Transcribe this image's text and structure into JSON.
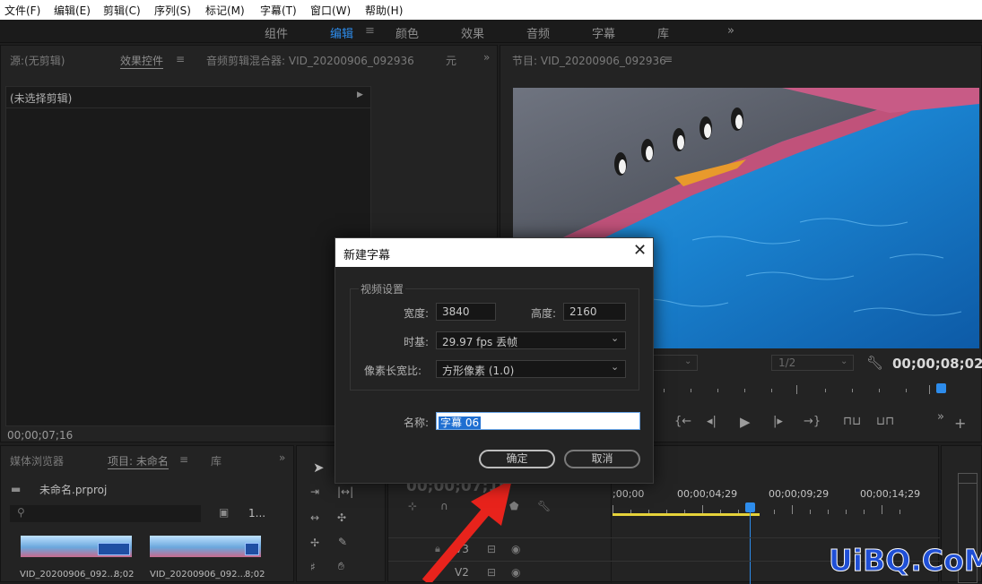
{
  "menu": [
    "文件(F)",
    "编辑(E)",
    "剪辑(C)",
    "序列(S)",
    "标记(M)",
    "字幕(T)",
    "窗口(W)",
    "帮助(H)"
  ],
  "workspaces": [
    "组件",
    "编辑",
    "颜色",
    "效果",
    "音频",
    "字幕",
    "库"
  ],
  "workspace_more": "»",
  "source_panel": {
    "tabs": [
      "源:(无剪辑)",
      "效果控件",
      "音频剪辑混合器: VID_20200906_092936",
      "元"
    ],
    "no_clip": "(未选择剪辑)",
    "timecode": "00;00;07;16"
  },
  "program_panel": {
    "title": "节目: VID_20200906_092936",
    "zoom": "1/2",
    "timecode": "00;00;08;02"
  },
  "project_panel": {
    "tabs": [
      "媒体浏览器",
      "项目: 未命名",
      "库"
    ],
    "project_file": "未命名.prproj",
    "count": "1...",
    "clips": [
      {
        "name": "VID_20200906_092...",
        "duration": "8;02"
      },
      {
        "name": "VID_20200906_092...",
        "duration": "8;02"
      }
    ]
  },
  "timeline": {
    "timecode": "00;00;07;16",
    "ruler": [
      ";00;00",
      "00;00;04;29",
      "00;00;09;29",
      "00;00;14;29"
    ],
    "tracks": [
      "V3",
      "V2"
    ]
  },
  "dialog": {
    "title": "新建字幕",
    "group_label": "视频设置",
    "width_label": "宽度:",
    "width_value": "3840",
    "height_label": "高度:",
    "height_value": "2160",
    "timebase_label": "时基:",
    "timebase_value": "29.97 fps 丢帧",
    "par_label": "像素长宽比:",
    "par_value": "方形像素 (1.0)",
    "name_label": "名称:",
    "name_value": "字幕 06",
    "ok": "确定",
    "cancel": "取消"
  },
  "watermark": "UiBQ.CoM",
  "colors": {
    "accent": "#2d8ceb",
    "annotation_arrow": "#e8231c",
    "watermark": "#1f4fd6",
    "timeline_bar": "#e6d23a"
  }
}
